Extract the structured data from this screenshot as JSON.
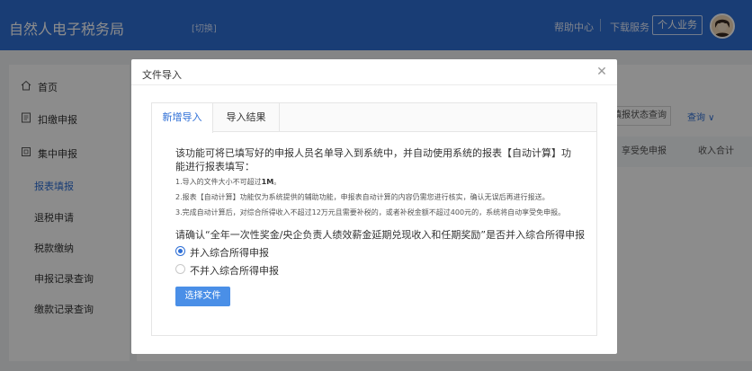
{
  "header": {
    "app_title": "自然人电子税务局",
    "switch_label": "[切换]",
    "help_label": "帮助中心",
    "download_label": "下载服务",
    "personal_label": "个人业务"
  },
  "sidebar": {
    "items": [
      {
        "label": "首页",
        "icon": "home-icon"
      },
      {
        "label": "扣缴申报",
        "icon": "document-icon"
      },
      {
        "label": "集中申报",
        "icon": "batch-icon"
      }
    ],
    "sub_items": [
      {
        "label": "报表填报",
        "active": true
      },
      {
        "label": "退税申请",
        "active": false
      },
      {
        "label": "税款缴纳",
        "active": false
      },
      {
        "label": "申报记录查询",
        "active": false
      },
      {
        "label": "缴款记录查询",
        "active": false
      }
    ]
  },
  "background": {
    "status_btn": "填报状态查询",
    "query_btn": "查询 ∨",
    "col_exempt": "享受免申报",
    "col_income": "收入合计"
  },
  "modal": {
    "title": "文件导入",
    "tabs": [
      {
        "label": "新增导入",
        "active": true
      },
      {
        "label": "导入结果",
        "active": false
      }
    ],
    "intro": "该功能可将已填写好的申报人员名单导入到系统中，并自动使用系统的报表【自动计算】功能进行报表填写：",
    "notes": [
      {
        "pre": "1.导入的文件大小不可超过",
        "strong": "1M",
        "post": "。"
      },
      {
        "pre": "2.报表【自动计算】功能仅为系统提供的辅助功能，申报表自动计算的内容仍需您进行核实，确认无误后再进行报送。",
        "strong": "",
        "post": ""
      },
      {
        "pre": "3.完成自动计算后，对综合所得收入不超过12万元且需要补税的，或者补税金额不超过400元的，系统将自动享受免申报。",
        "strong": "",
        "post": ""
      }
    ],
    "question": "请确认“全年一次性奖金/央企负责人绩效薪金延期兑现收入和任期奖励”是否并入综合所得申报",
    "options": [
      {
        "label": "并入综合所得申报",
        "checked": true
      },
      {
        "label": "不并入综合所得申报",
        "checked": false
      }
    ],
    "choose_label": "选择文件"
  }
}
